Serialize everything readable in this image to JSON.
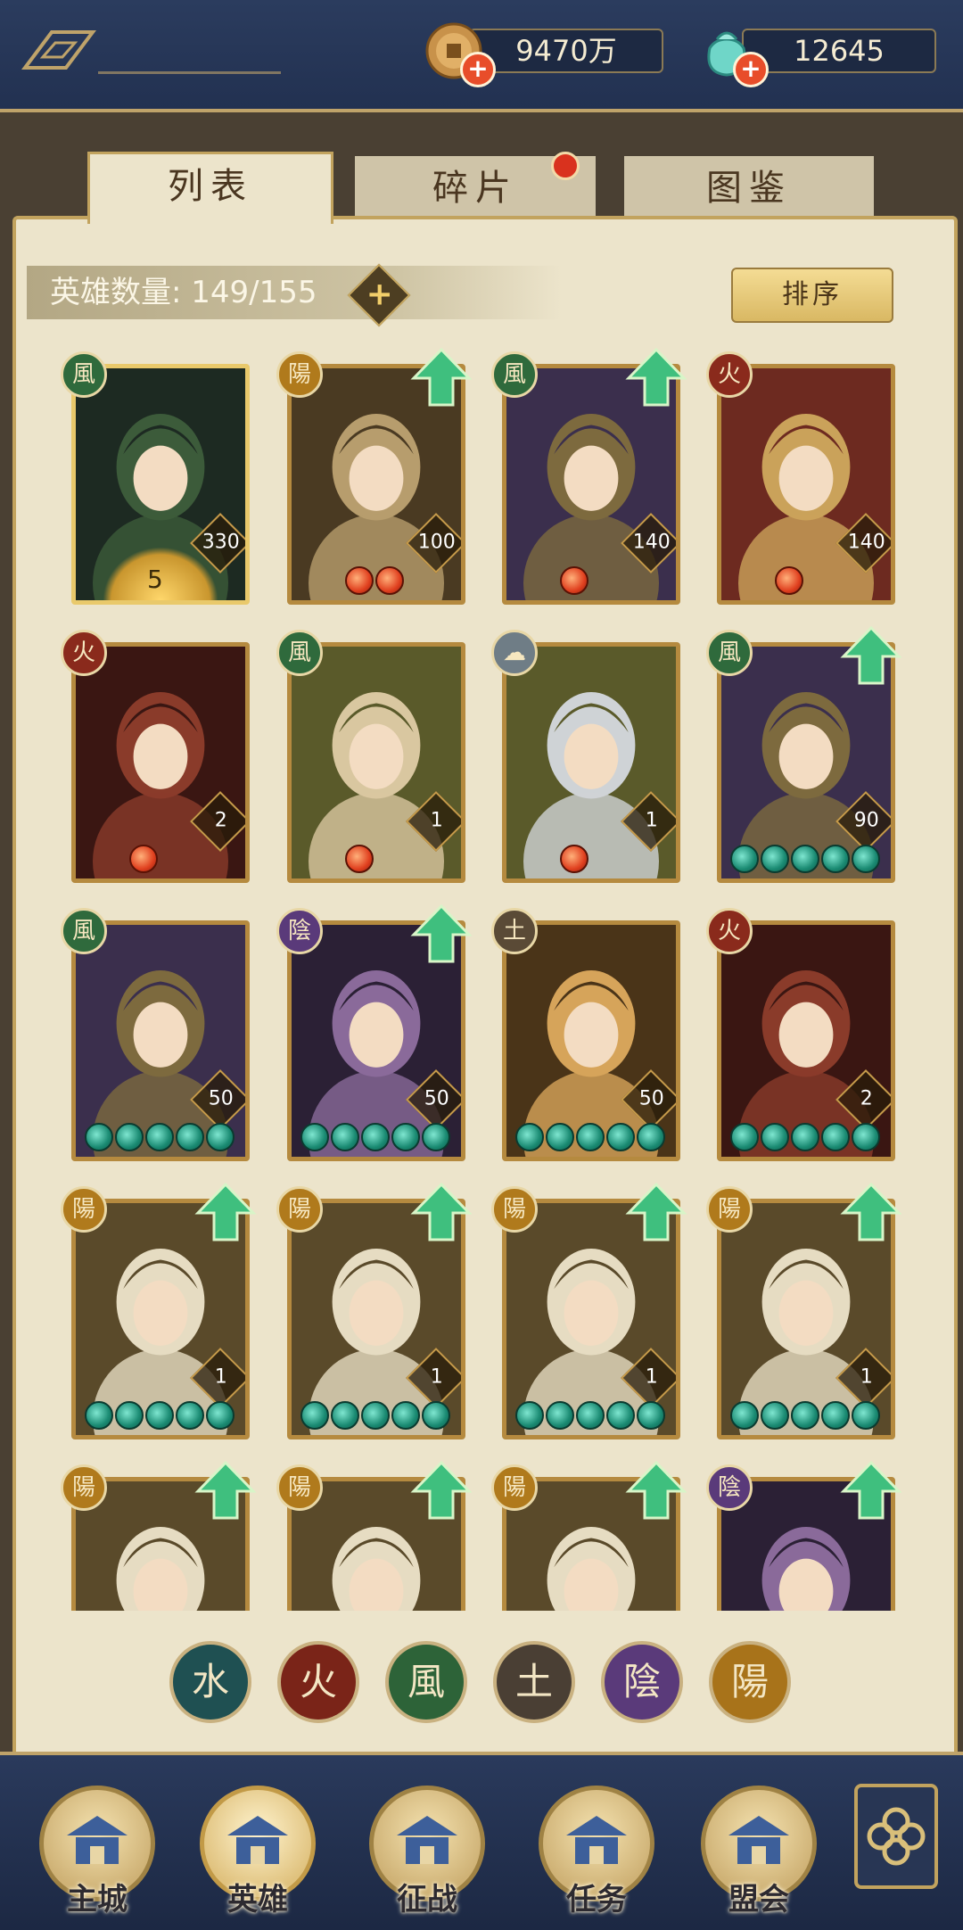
{
  "currency": {
    "coins": "9470万",
    "gems": "12645"
  },
  "tabs": [
    {
      "label": "列表",
      "active": true
    },
    {
      "label": "碎片",
      "active": false,
      "badge": true
    },
    {
      "label": "图鉴",
      "active": false
    }
  ],
  "hero_count": {
    "label": "英雄数量: 149/155"
  },
  "sort_label": "排序",
  "elements": {
    "wind": "風",
    "fire": "火",
    "yang": "陽",
    "yin": "陰",
    "earth": "土",
    "cloud": "☁",
    "water": "水"
  },
  "heroes": [
    {
      "element": "wind",
      "level": "330",
      "gems": 0,
      "gem_color": "teal",
      "upgrade": false,
      "star_base": "5",
      "art": "dark"
    },
    {
      "element": "yang",
      "level": "100",
      "gems": 2,
      "gem_color": "red",
      "upgrade": true,
      "art": "gold"
    },
    {
      "element": "wind",
      "level": "140",
      "gems": 1,
      "gem_color": "red",
      "upgrade": true,
      "art": "purple"
    },
    {
      "element": "fire",
      "level": "140",
      "gems": 1,
      "gem_color": "red",
      "upgrade": false,
      "art": "red"
    },
    {
      "element": "fire",
      "level": "2",
      "gems": 1,
      "gem_color": "red",
      "upgrade": false,
      "art": "crimson"
    },
    {
      "element": "wind",
      "level": "1",
      "gems": 1,
      "gem_color": "red",
      "upgrade": false,
      "art": "green"
    },
    {
      "element": "cloud",
      "level": "1",
      "gems": 1,
      "gem_color": "red",
      "upgrade": false,
      "art": "blue"
    },
    {
      "element": "wind",
      "level": "90",
      "gems": 5,
      "gem_color": "teal",
      "upgrade": true,
      "art": "purple"
    },
    {
      "element": "wind",
      "level": "50",
      "gems": 5,
      "gem_color": "teal",
      "upgrade": false,
      "art": "purple"
    },
    {
      "element": "yin",
      "level": "50",
      "gems": 5,
      "gem_color": "teal",
      "upgrade": true,
      "art": "violet"
    },
    {
      "element": "earth",
      "level": "50",
      "gems": 5,
      "gem_color": "teal",
      "upgrade": false,
      "art": "brown"
    },
    {
      "element": "fire",
      "level": "2",
      "gems": 5,
      "gem_color": "teal",
      "upgrade": false,
      "art": "crimson"
    },
    {
      "element": "yang",
      "level": "1",
      "gems": 5,
      "gem_color": "teal",
      "upgrade": true,
      "art": "cream"
    },
    {
      "element": "yang",
      "level": "1",
      "gems": 5,
      "gem_color": "teal",
      "upgrade": true,
      "art": "cream"
    },
    {
      "element": "yang",
      "level": "1",
      "gems": 5,
      "gem_color": "teal",
      "upgrade": true,
      "art": "cream"
    },
    {
      "element": "yang",
      "level": "1",
      "gems": 5,
      "gem_color": "teal",
      "upgrade": true,
      "art": "cream"
    },
    {
      "element": "yang",
      "level": "",
      "gems": 0,
      "gem_color": "teal",
      "upgrade": true,
      "art": "cream"
    },
    {
      "element": "yang",
      "level": "",
      "gems": 0,
      "gem_color": "teal",
      "upgrade": true,
      "art": "cream"
    },
    {
      "element": "yang",
      "level": "",
      "gems": 0,
      "gem_color": "teal",
      "upgrade": true,
      "art": "cream"
    },
    {
      "element": "yin",
      "level": "",
      "gems": 0,
      "gem_color": "teal",
      "upgrade": true,
      "art": "violet"
    }
  ],
  "filters": [
    "水",
    "火",
    "風",
    "土",
    "陰",
    "陽"
  ],
  "filter_colors": [
    "#1f5052",
    "#7a2418",
    "#2d6338",
    "#4a3f34",
    "#5a3a7a",
    "#a8731a"
  ],
  "nav": [
    {
      "label": "主城",
      "icon": "city-gate-icon"
    },
    {
      "label": "英雄",
      "icon": "hero-portrait-icon",
      "active": true
    },
    {
      "label": "征战",
      "icon": "battle-drum-icon"
    },
    {
      "label": "任务",
      "icon": "task-scroll-icon"
    },
    {
      "label": "盟会",
      "icon": "guild-pavilion-icon"
    }
  ]
}
